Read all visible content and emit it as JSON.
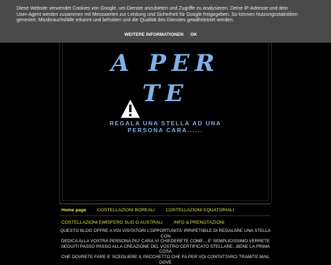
{
  "cookie": {
    "text": "Diese Website verwendet Cookies von Google, um Dienste anzubieten und Zugriffe zu analysieren. Deine IP-Adresse und dein User-Agent werden zusammen mit Messwerten zur Leistung und Sicherheit für Google freigegeben. So können Nutzungsstatistiken generiert, Missbrauchsfälle erkannt und behoben und die Qualität des Dienstes gewährleistet werden.",
    "more_label": "WEITERE INFORMATIONEN",
    "ok_label": "OK"
  },
  "header": {
    "title_line1": "A PER",
    "title_line2": "TE",
    "tagline_line1": "REGALA UNA STELLA AD UNA",
    "tagline_line2": "PERSONA CARA......"
  },
  "icons": {
    "warning": "warning-icon"
  },
  "nav": {
    "items": [
      {
        "label": "Home page",
        "active": true
      },
      {
        "label": "COSTELLAZIONI BOREALI"
      },
      {
        "label": "COSTELLAZIONI EQUATORIALI"
      },
      {
        "label": "COSTELLAZIONI EMISFERO SUD O AUSTRALI"
      },
      {
        "label": "INFO & PRENOTAZIONI"
      }
    ]
  },
  "post": {
    "line1": "QUESTO BLOG OFFRE A VOI VISITATORI L'OPPORTUNITA' IRRIPETIBILE DI REGALARE UNA STELLA CON",
    "line2": "DEDICA ALLA VOSTRA PERSONA PIU' CARA,VI CHIEDERETE COME....E' SEMPLICISSIMO VERRETE",
    "line3": "SEGUITI PASSO PASSO ALLA CREAZIONE DEL VOSTRO CERTIFICATO STELLARE...BENE LA PRIMA COSA",
    "line4": "CHE DOVRETE FARE E' SCEGLIERE IL PACCHETTO CHE FA PER VOI CONTATTARCI TRAMITE MAIL DOVE"
  },
  "colors": {
    "background": "#000000",
    "cookie_bar": "#4a4a4a",
    "title": "#7fb2e6",
    "nav": "#d9e34d"
  }
}
